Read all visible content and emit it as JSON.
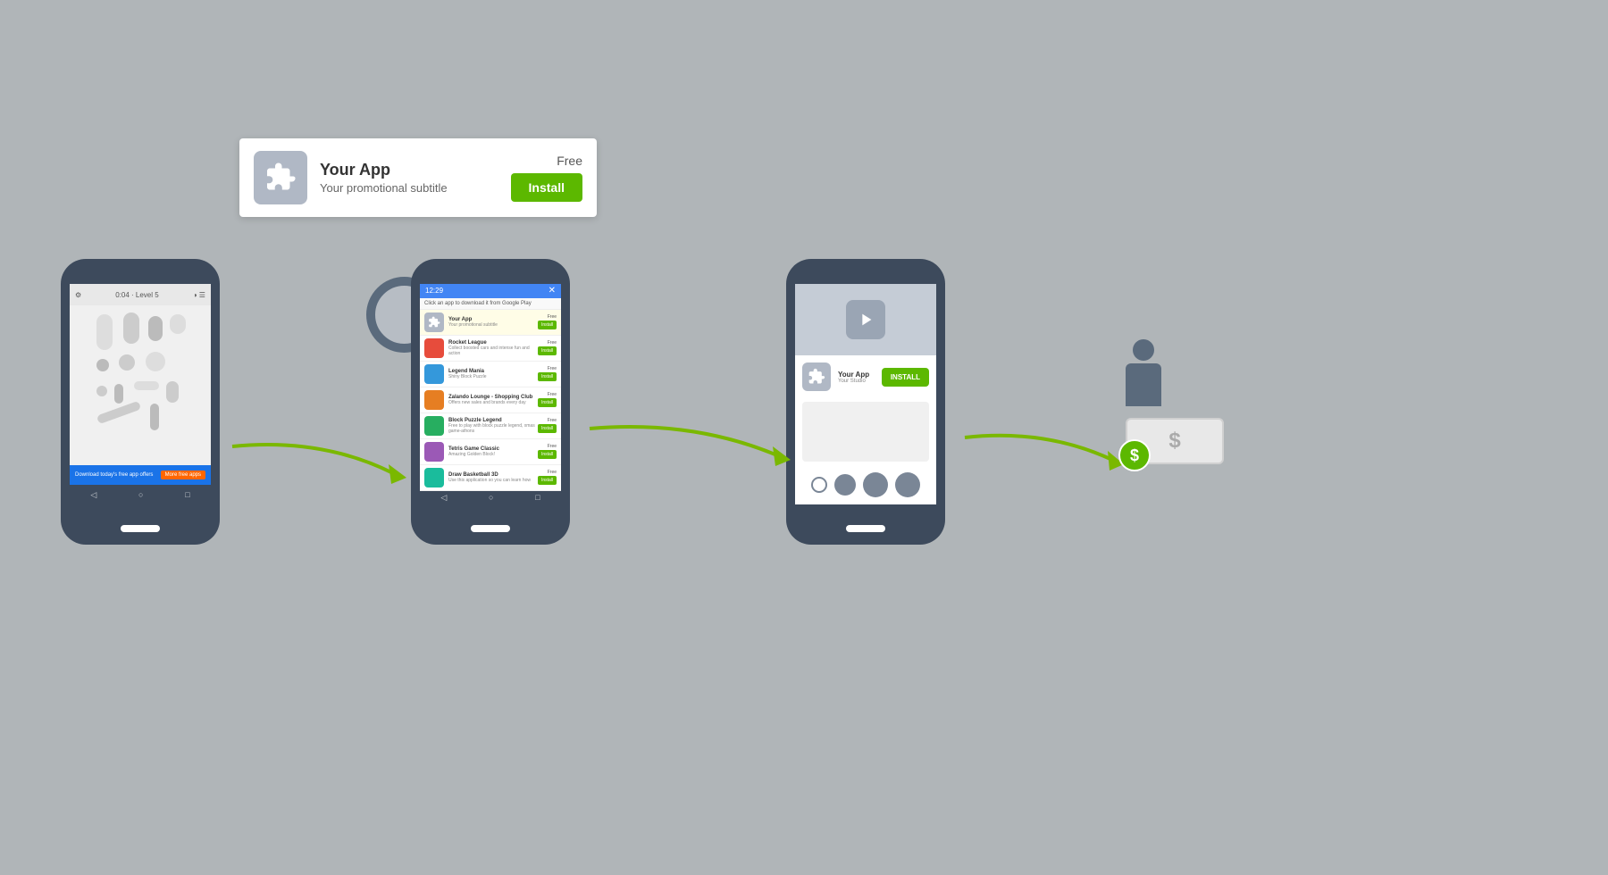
{
  "adBanner": {
    "appName": "Your App",
    "price": "Free",
    "subtitle": "Your promotional subtitle",
    "installLabel": "Install"
  },
  "phone1": {
    "statusbar": {
      "time": "0:04 · Level 5"
    },
    "banner": {
      "text": "Download today's free app offers",
      "button": "More free apps"
    }
  },
  "phone2": {
    "statusbar": {
      "time": "12:29"
    },
    "hint": "Click an app to download it from Google Play",
    "items": [
      {
        "name": "Rocket League",
        "desc": "Collect boosted cars and intense fun and action",
        "price": "Free",
        "install": "Install"
      },
      {
        "name": "Your App",
        "subtitle": "Your promotional subtitle",
        "price": "Free",
        "install": "Install",
        "isAd": true
      },
      {
        "name": "Legend Mania",
        "desc": "Shiny Block Puzzle",
        "price": "Free",
        "install": "Install"
      },
      {
        "name": "Zalando Lounge - Shopping Club",
        "desc": "Offers new sales and brands every day",
        "price": "Free",
        "install": "Install"
      },
      {
        "name": "Block Puzzle Legend",
        "desc": "Free to play with block puzzle legend, xmas game-athons",
        "price": "Free",
        "install": "Install"
      },
      {
        "name": "Tetris Game Classic",
        "desc": "Amazing Golden Block!",
        "price": "Free",
        "install": "Install"
      },
      {
        "name": "Draw Basketball 3D",
        "desc": "Use this application so you can learn how",
        "price": "Free",
        "install": "Install"
      }
    ]
  },
  "phone3": {
    "installLabel": "INSTALL"
  },
  "arrows": {
    "arrow1Label": "Arrow from phone1 to phone2",
    "arrow2Label": "Arrow from phone2 to phone3",
    "arrow3Label": "Arrow from phone3 to money"
  },
  "moneySection": {
    "dollarSymbol": "$"
  }
}
